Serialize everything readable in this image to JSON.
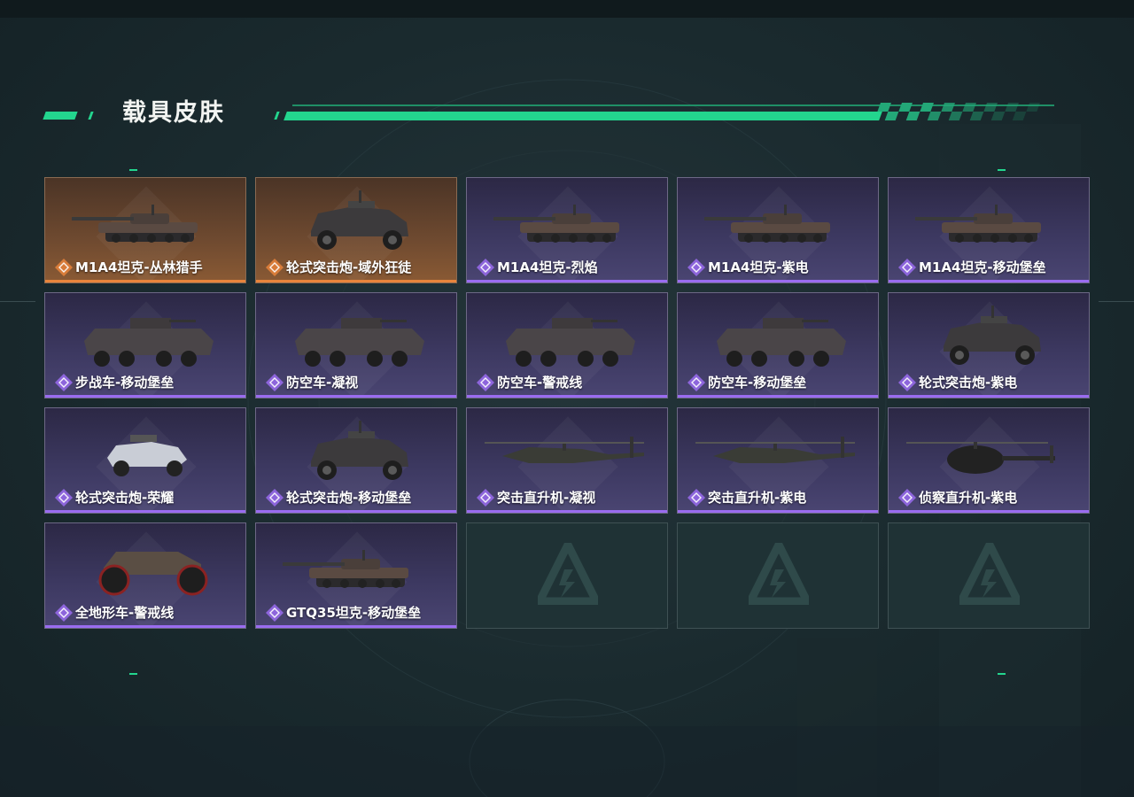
{
  "page": {
    "title": "载具皮肤",
    "accent_color": "#23d58e"
  },
  "rarity_colors": {
    "legendary": "#e8843c",
    "epic": "#9a6cf0"
  },
  "skins": [
    {
      "name": "M1A4坦克-丛林猎手",
      "rarity": "legendary",
      "vehicle": "tank-icon"
    },
    {
      "name": "轮式突击炮-域外狂徒",
      "rarity": "legendary",
      "vehicle": "armored-car-icon"
    },
    {
      "name": "M1A4坦克-烈焰",
      "rarity": "epic",
      "vehicle": "tank-icon"
    },
    {
      "name": "M1A4坦克-紫电",
      "rarity": "epic",
      "vehicle": "tank-icon"
    },
    {
      "name": "M1A4坦克-移动堡垒",
      "rarity": "epic",
      "vehicle": "tank-icon"
    },
    {
      "name": "步战车-移动堡垒",
      "rarity": "epic",
      "vehicle": "ifv-icon"
    },
    {
      "name": "防空车-凝视",
      "rarity": "epic",
      "vehicle": "ifv-icon"
    },
    {
      "name": "防空车-警戒线",
      "rarity": "epic",
      "vehicle": "ifv-icon"
    },
    {
      "name": "防空车-移动堡垒",
      "rarity": "epic",
      "vehicle": "ifv-icon"
    },
    {
      "name": "轮式突击炮-紫电",
      "rarity": "epic",
      "vehicle": "armored-car-icon"
    },
    {
      "name": "轮式突击炮-荣耀",
      "rarity": "epic",
      "vehicle": "buggy-icon"
    },
    {
      "name": "轮式突击炮-移动堡垒",
      "rarity": "epic",
      "vehicle": "armored-car-icon"
    },
    {
      "name": "突击直升机-凝视",
      "rarity": "epic",
      "vehicle": "helicopter-icon"
    },
    {
      "name": "突击直升机-紫电",
      "rarity": "epic",
      "vehicle": "helicopter-icon"
    },
    {
      "name": "侦察直升机-紫电",
      "rarity": "epic",
      "vehicle": "scout-helicopter-icon"
    },
    {
      "name": "全地形车-警戒线",
      "rarity": "epic",
      "vehicle": "atv-icon"
    },
    {
      "name": "GTQ35坦克-移动堡垒",
      "rarity": "epic",
      "vehicle": "tank-icon"
    }
  ],
  "empty_slots": 3
}
